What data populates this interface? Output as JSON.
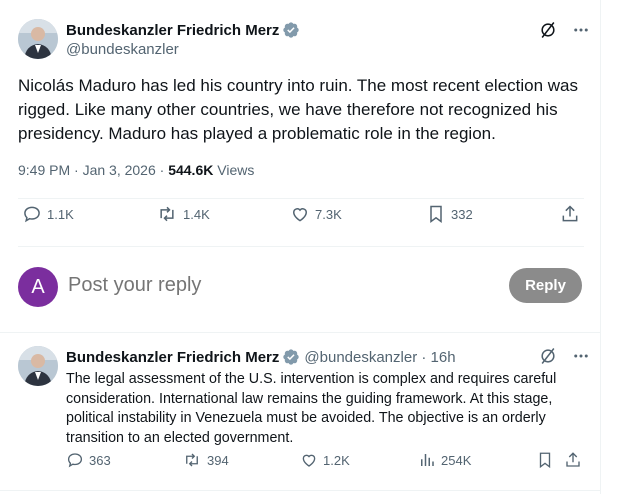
{
  "tweet": {
    "author_name": "Bundeskanzler Friedrich Merz",
    "author_handle": "@bundeskanzler",
    "text": "Nicolás Maduro has led his country into ruin. The most recent election was rigged. Like many other countries, we have therefore not recognized his presidency. Maduro has played a problematic role in the region.",
    "time": "9:49 PM · Jan 3, 2026 · ",
    "views_count": "544.6K",
    "views_label": " Views",
    "stats": {
      "replies": "1.1K",
      "reposts": "1.4K",
      "likes": "7.3K",
      "bookmarks": "332"
    }
  },
  "composer": {
    "avatar_letter": "A",
    "placeholder": "Post your reply",
    "reply_button": "Reply"
  },
  "reply_post": {
    "author_name": "Bundeskanzler Friedrich Merz",
    "author_handle": "@bundeskanzler",
    "separator": " · ",
    "age": "16h",
    "text": "The legal assessment of the U.S. intervention is complex and requires careful consideration. International law remains the guiding framework. At this stage, political instability in Venezuela must be avoided. The objective is an orderly transition to an elected government.",
    "stats": {
      "replies": "363",
      "reposts": "394",
      "likes": "1.2K",
      "views": "254K"
    }
  },
  "colors": {
    "verified": "#829aab",
    "avatar_letter_bg": "#7b2e9e",
    "reply_button_bg": "#8b8b8b",
    "muted_text": "#536471"
  }
}
